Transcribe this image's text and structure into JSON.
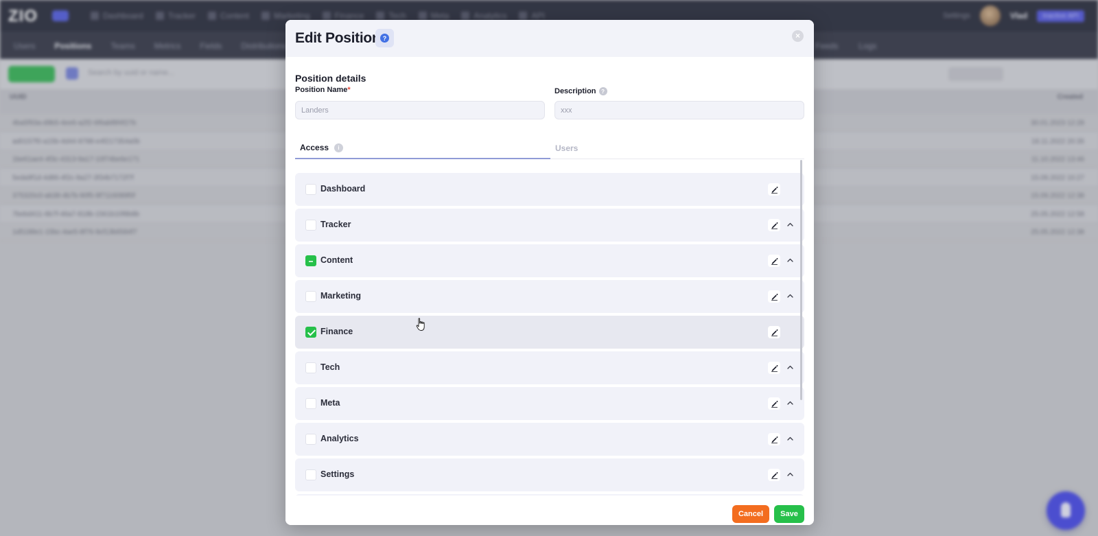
{
  "background": {
    "logo": "ZIO",
    "top_nav": [
      "Dashboard",
      "Tracker",
      "Content",
      "Marketing",
      "Finance",
      "Tech",
      "Meta",
      "Analytics",
      "API"
    ],
    "top_right": {
      "settings": "Settings",
      "user_name": "Vlad",
      "pill": "Inactive API"
    },
    "sub_nav": [
      "Users",
      "Positions",
      "Teams",
      "Metrics",
      "Fields",
      "Distributions"
    ],
    "sub_nav_right": [
      "Feeds",
      "Logs"
    ],
    "search_placeholder": "Search by uuid or name...",
    "table_header": {
      "left": "UUID",
      "right": "Created"
    },
    "rows": [
      {
        "uuid": "4ba5f93a-d9b5-4ee6-a2f2-6f6abf8f4f27b",
        "date": "30.01.2023 12:28"
      },
      {
        "uuid": "ad0157f0-a15b-4d44-8788-e4f217354a0b",
        "date": "18.11.2022 20:35"
      },
      {
        "uuid": "1be61ae4-4f3c-4313-9a17-10f74be6e171",
        "date": "11.10.2022 13:46"
      },
      {
        "uuid": "5eda9f1d-4d86-4f2c-9a27-3f34b7172f7f",
        "date": "15.09.2022 10:27"
      },
      {
        "uuid": "375320c0-ab38-4b7b-90f5-9f7116089f0f",
        "date": "15.09.2022 12:38"
      },
      {
        "uuid": "7bebd411-6b7f-46a7-818b-1561b10f8b8b",
        "date": "25.05.2022 12:58"
      },
      {
        "uuid": "1d5188e1-15bc-4ae5-8f76-9cf13b6584f7",
        "date": "25.05.2022 12:38"
      }
    ]
  },
  "modal": {
    "title": "Edit Position",
    "help_glyph": "?",
    "close_glyph": "×",
    "section_title": "Position details",
    "position_name": {
      "label": "Position Name",
      "required_mark": "*",
      "value": "Landers"
    },
    "description": {
      "label": "Description",
      "value": "xxx"
    },
    "tabs": [
      {
        "label": "Access",
        "active": true
      },
      {
        "label": "Users",
        "active": false
      }
    ],
    "access_items": [
      {
        "label": "Dashboard",
        "state": "unchecked",
        "expandable": false
      },
      {
        "label": "Tracker",
        "state": "unchecked",
        "expandable": true
      },
      {
        "label": "Content",
        "state": "partial",
        "expandable": true
      },
      {
        "label": "Marketing",
        "state": "unchecked",
        "expandable": true
      },
      {
        "label": "Finance",
        "state": "checked",
        "expandable": false
      },
      {
        "label": "Tech",
        "state": "unchecked",
        "expandable": true
      },
      {
        "label": "Meta",
        "state": "unchecked",
        "expandable": true
      },
      {
        "label": "Analytics",
        "state": "unchecked",
        "expandable": true
      },
      {
        "label": "Settings",
        "state": "unchecked",
        "expandable": true
      }
    ],
    "buttons": {
      "cancel": "Cancel",
      "save": "Save"
    }
  },
  "colors": {
    "save": "#26c04a",
    "cancel": "#f36d1f",
    "checkbox_checked": "#26c04a",
    "help_badge": "#4270e4",
    "fab": "#3d3fe8",
    "required": "#e84a3b"
  }
}
